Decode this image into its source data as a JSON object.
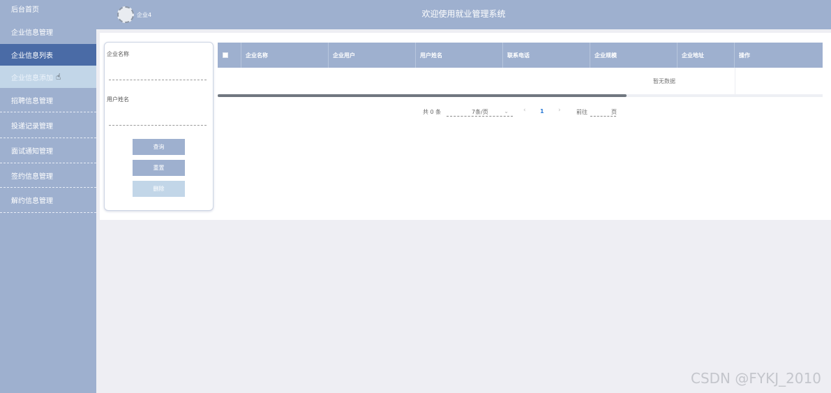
{
  "sidebar": {
    "items": [
      {
        "label": "后台首页"
      },
      {
        "label": "企业信息管理"
      },
      {
        "label": "企业信息列表"
      },
      {
        "label": "企业信息添加"
      },
      {
        "label": "招聘信息管理"
      },
      {
        "label": "投递记录管理"
      },
      {
        "label": "面试通知管理"
      },
      {
        "label": "签约信息管理"
      },
      {
        "label": "解约信息管理"
      }
    ]
  },
  "header": {
    "title": "欢迎使用就业管理系统",
    "user": "企业4"
  },
  "search": {
    "field1_label": "企业名称",
    "field1_value": "",
    "field2_label": "用户姓名",
    "field2_value": "",
    "query_label": "查询",
    "reset_label": "重置",
    "delete_label": "删除"
  },
  "table": {
    "columns": [
      "企业名称",
      "企业用户",
      "用户姓名",
      "联系电话",
      "企业规模",
      "企业地址",
      "操作"
    ],
    "empty_text": "暂无数据"
  },
  "pagination": {
    "total": "共 0 条",
    "page_size": "7条/页",
    "current_page": "1",
    "goto_label": "前往",
    "page_unit": "页"
  },
  "watermark": "CSDN @FYKJ_2010",
  "colors": {
    "sidebar_bg": "#9eb0cf",
    "sidebar_active": "#4a6ba6",
    "sidebar_hover": "#c2d6e8",
    "button_primary": "#9eb0cf"
  }
}
